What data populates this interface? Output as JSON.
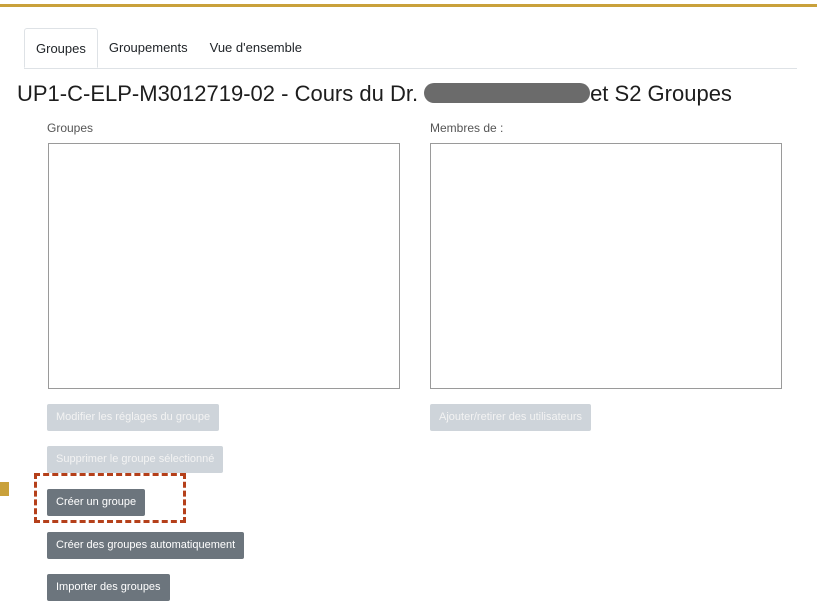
{
  "colors": {
    "accent_rule": "#c9a13b",
    "highlight": "#b5401a",
    "button_dark": "#6c757d",
    "button_disabled": "#ced4da"
  },
  "tabs": [
    {
      "label": "Groupes",
      "active": true
    },
    {
      "label": "Groupements",
      "active": false
    },
    {
      "label": "Vue d'ensemble",
      "active": false
    }
  ],
  "title": {
    "prefix": "UP1-C-ELP-M3012719-02 - Cours du Dr.",
    "suffix": "et S2 Groupes"
  },
  "groups_panel": {
    "label": "Groupes",
    "buttons": {
      "edit": "Modifier les réglages du groupe",
      "delete": "Supprimer le groupe sélectionné",
      "create": "Créer un groupe",
      "auto_create": "Créer des groupes automatiquement",
      "import": "Importer des groupes"
    }
  },
  "members_panel": {
    "label": "Membres de :",
    "buttons": {
      "add_remove": "Ajouter/retirer des utilisateurs"
    }
  }
}
